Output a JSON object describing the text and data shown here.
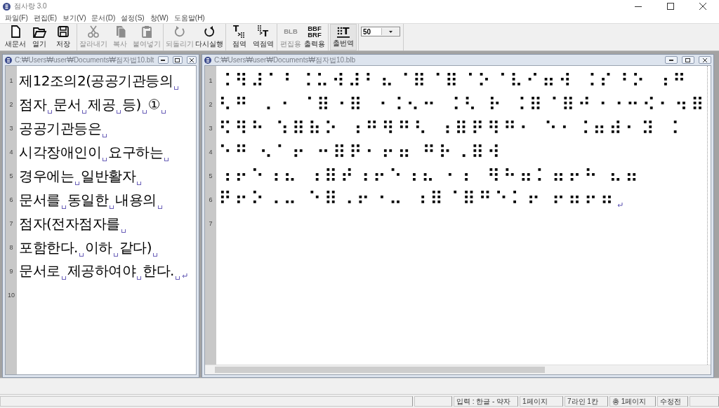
{
  "app": {
    "title": "점사랑 3.0"
  },
  "menu": [
    {
      "label": "파일(F)"
    },
    {
      "label": "편집(E)"
    },
    {
      "label": "보기(V)"
    },
    {
      "label": "문서(D)"
    },
    {
      "label": "설정(S)"
    },
    {
      "label": "창(W)"
    },
    {
      "label": "도움말(H)"
    }
  ],
  "toolbar": {
    "groups": [
      [
        {
          "kind": "new",
          "label": "새문서",
          "disabled": false,
          "pressed": false
        },
        {
          "kind": "open",
          "label": "열기",
          "disabled": false,
          "pressed": false
        },
        {
          "kind": "save",
          "label": "저장",
          "disabled": false,
          "pressed": false
        }
      ],
      [
        {
          "kind": "cut",
          "label": "잘라내기",
          "disabled": true,
          "pressed": false
        },
        {
          "kind": "copy",
          "label": "복사",
          "disabled": true,
          "pressed": false
        },
        {
          "kind": "paste",
          "label": "붙여넣기",
          "disabled": true,
          "pressed": false
        }
      ],
      [
        {
          "kind": "undo",
          "label": "되돌리기",
          "disabled": true,
          "pressed": false
        },
        {
          "kind": "redo",
          "label": "다시실행",
          "disabled": false,
          "pressed": false
        }
      ],
      [
        {
          "kind": "to-braille",
          "label": "점역",
          "glyph": "T",
          "disabled": false,
          "pressed": false
        },
        {
          "kind": "from-braille",
          "label": "역점역",
          "glyph": "T",
          "disabled": false,
          "pressed": false
        }
      ],
      [
        {
          "kind": "stacked-text",
          "label": "편집용",
          "glyphs": [
            "BLB"
          ],
          "disabled": true,
          "pressed": false
        },
        {
          "kind": "stacked-text",
          "label": "출력용",
          "glyphs": [
            "BBF",
            "BRF"
          ],
          "disabled": false,
          "pressed": false
        }
      ],
      [
        {
          "kind": "braille-text",
          "label": "출번역",
          "glyph": "T",
          "disabled": false,
          "pressed": true
        }
      ]
    ],
    "zoom_select": {
      "value": "50"
    }
  },
  "text_window": {
    "title": "C:₩Users₩user₩Documents₩점자법10.blt",
    "lines": [
      {
        "number": "1",
        "text": "제12조의2(공공기관등의 ",
        "paragraph_end": false
      },
      {
        "number": "2",
        "text": "점자 문서 제공 등) ① ",
        "paragraph_end": false
      },
      {
        "number": "3",
        "text": "공공기관등은 ",
        "paragraph_end": false
      },
      {
        "number": "4",
        "text": "시각장애인이 요구하는 ",
        "paragraph_end": false
      },
      {
        "number": "5",
        "text": "경우에는 일반활자 ",
        "paragraph_end": false
      },
      {
        "number": "6",
        "text": "문서를 동일한 내용의 ",
        "paragraph_end": false
      },
      {
        "number": "7",
        "text": "점자(전자점자를 ",
        "paragraph_end": false
      },
      {
        "number": "8",
        "text": "포함한다. 이하 같다) ",
        "paragraph_end": false
      },
      {
        "number": "9",
        "text": "문서로 제공하여야 한다. ",
        "paragraph_end": true
      },
      {
        "number": "10"
      }
    ]
  },
  "braille_window": {
    "title": "C:₩Users₩user₩Documents₩점자법10.blb",
    "lines": [
      {
        "number": "1",
        "text": "⠨⠻⠼⠁⠃⠨⠥⠺⠼⠃⠦⠈⠿⠈⠿⠈⠕⠈⠧⠊⠶⠺ ⠨⠎⠘⠕ ⠰⠛",
        "paragraph_end": false
      },
      {
        "number": "2",
        "text": "⠣⠛ ⠠⠐ ⠈⠿⠐⠿ ⠐⠨⠢⠒ ⠨⠣ ⠗ ⠨⠿⠈⠿⠚⠐⠐⠒⠪⠂⠲⠿",
        "paragraph_end": false
      },
      {
        "number": "3",
        "text": "⠫⠻⠓ ⠱⠿⠷⠕ ⠰⠛⠻⠛⠣ ⠰⠿⠟⠻⠛⠂ ⠑⠂⠨⠶⠾⠂⠽ ⠨",
        "paragraph_end": false
      },
      {
        "number": "4",
        "text": "⠑⠛ ⠢⠁⠖ ⠒⠿⠟⠂⠖⠶ ⠛⠗⠠⠿⠺",
        "paragraph_end": false
      },
      {
        "number": "5",
        "text": "⠰⠖⠑⠰⠦ ⠰⠿⠞⠰⠖⠑⠰⠦ ⠂⠆ ⠻⠓⠶⠅⠶⠖⠓ ⠦⠶",
        "paragraph_end": false
      },
      {
        "number": "6",
        "text": "⠟⠖⠕⠠⠤ ⠑⠿⠠⠖⠐⠤ ⠰⠿⠈⠿⠛⠑⠅⠖ ⠖⠶⠖⠶",
        "paragraph_end": true
      },
      {
        "number": "7"
      }
    ]
  },
  "status_bar": [
    {
      "text": "입력 : 한글 - 약자"
    },
    {
      "text": "1페이지"
    },
    {
      "text": "7라인 1칸"
    },
    {
      "text": "총 1페이지"
    },
    {
      "text": "수정전"
    }
  ]
}
